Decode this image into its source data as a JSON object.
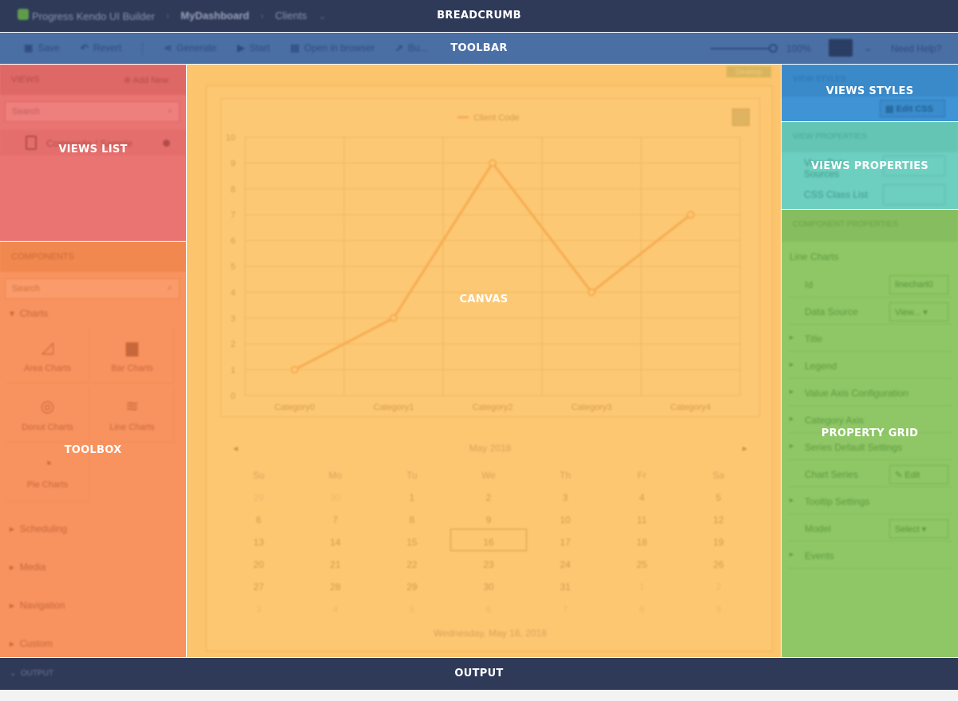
{
  "regions": {
    "breadcrumb": "BREADCRUMB",
    "toolbar": "TOOLBAR",
    "views_list": "VIEWS LIST",
    "toolbox": "TOOLBOX",
    "canvas": "CANVAS",
    "views_styles": "VIEWS STYLES",
    "views_properties": "VIEWS PROPERTIES",
    "property_grid": "PROPERTY GRID",
    "output": "OUTPUT"
  },
  "colors": {
    "breadcrumb": "#2f3a59",
    "toolbar": "#4a6fa5",
    "views_list": "#ea7472",
    "toolbox": "#f8935f",
    "canvas": "#fcc46c",
    "views_styles": "#3f94d6",
    "views_properties": "#6dcfc0",
    "property_grid": "#8fc767",
    "output": "#2f3a59"
  },
  "breadcrumb": {
    "app": "Progress Kendo UI Builder",
    "project": "MyDashboard",
    "module": "Clients"
  },
  "toolbar": {
    "save": "Save",
    "revert": "Revert",
    "generate": "Generate",
    "start": "Start",
    "open_browser": "Open in browser",
    "build": "Bu...",
    "zoom": "100%",
    "help": "Need Help?"
  },
  "views_list": {
    "header": "VIEWS",
    "add": "Add New",
    "search_placeholder": "Search",
    "item": "Composite / Sample"
  },
  "toolbox": {
    "header": "COMPONENTS",
    "search_placeholder": "Search",
    "charts_category": "Charts",
    "tiles": [
      "Area Charts",
      "Bar Charts",
      "Donut Charts",
      "Line Charts",
      "Pie Charts"
    ],
    "categories": [
      "Scheduling",
      "Media",
      "Navigation",
      "Custom"
    ]
  },
  "canvas": {
    "tag": "Desktop",
    "calendar": {
      "month": "May 2018",
      "days": [
        "Su",
        "Mo",
        "Tu",
        "We",
        "Th",
        "Fr",
        "Sa"
      ],
      "weeks": [
        [
          "29",
          "30",
          "1",
          "2",
          "3",
          "4",
          "5"
        ],
        [
          "6",
          "7",
          "8",
          "9",
          "10",
          "11",
          "12"
        ],
        [
          "13",
          "14",
          "15",
          "16",
          "17",
          "18",
          "19"
        ],
        [
          "20",
          "21",
          "22",
          "23",
          "24",
          "25",
          "26"
        ],
        [
          "27",
          "28",
          "29",
          "30",
          "31",
          "1",
          "2"
        ],
        [
          "3",
          "4",
          "5",
          "6",
          "7",
          "8",
          "9"
        ]
      ],
      "footer": "Wednesday, May 16, 2018"
    }
  },
  "chart_data": {
    "type": "line",
    "categories": [
      "Category0",
      "Category1",
      "Category2",
      "Category3",
      "Category4"
    ],
    "series": [
      {
        "name": "Client Code",
        "values": [
          1,
          3,
          9,
          4,
          7
        ]
      }
    ],
    "ylim": [
      0,
      10
    ],
    "yticks": [
      0,
      1,
      2,
      3,
      4,
      5,
      6,
      7,
      8,
      9,
      10
    ],
    "grid": true,
    "legend": "top-center"
  },
  "views_styles": {
    "header": "VIEW STYLES",
    "edit_css": "Edit CSS"
  },
  "views_properties": {
    "header": "VIEW PROPERTIES",
    "data_sources": "View Data Sources",
    "css_class_list": "CSS Class List"
  },
  "property_grid": {
    "header": "COMPONENT PROPERTIES",
    "title": "Line Charts",
    "rows": [
      {
        "label": "Id",
        "value": "linechart0",
        "expandable": false
      },
      {
        "label": "Data Source",
        "value": "View... ▾",
        "expandable": false
      },
      {
        "label": "Title",
        "value": "",
        "expandable": true
      },
      {
        "label": "Legend",
        "value": "",
        "expandable": true
      },
      {
        "label": "Value Axis Configuration",
        "value": "",
        "expandable": true
      },
      {
        "label": "Category Axis",
        "value": "",
        "expandable": true
      },
      {
        "label": "Series Default Settings",
        "value": "",
        "expandable": true
      },
      {
        "label": "Chart Series",
        "value": "✎ Edit",
        "expandable": false
      },
      {
        "label": "Tooltip Settings",
        "value": "",
        "expandable": true
      },
      {
        "label": "Model",
        "value": "Select ▾",
        "expandable": false
      },
      {
        "label": "Events",
        "value": "",
        "expandable": true
      }
    ]
  },
  "output": {
    "label": "OUTPUT"
  }
}
